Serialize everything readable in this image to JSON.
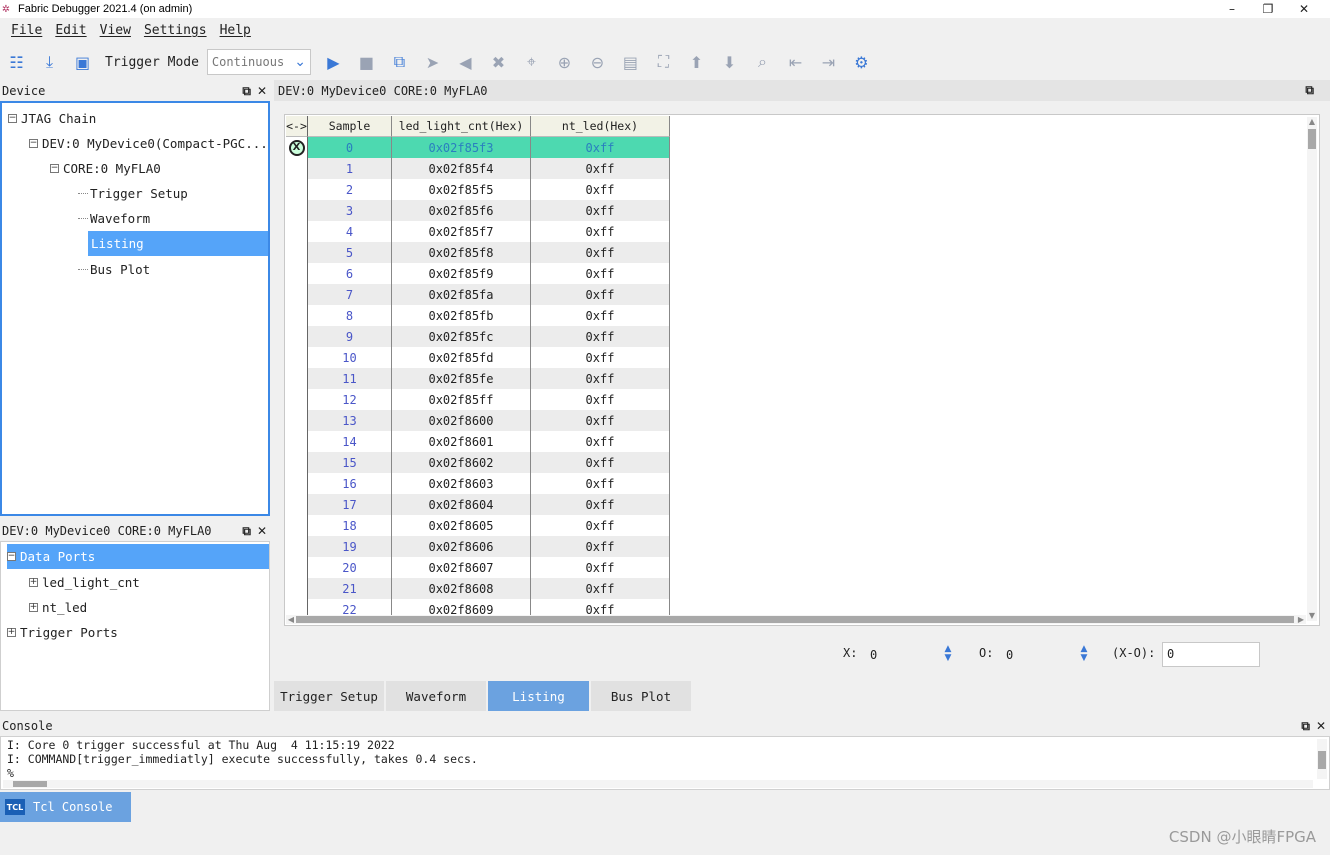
{
  "window": {
    "title": "Fabric Debugger 2021.4 (on admin)",
    "minimize": "–",
    "maximize": "❐",
    "close": "✕"
  },
  "menu": [
    "File",
    "Edit",
    "View",
    "Settings",
    "Help"
  ],
  "toolbar": {
    "trigger_mode_label": "Trigger Mode",
    "trigger_mode_value": "Continuous"
  },
  "device_panel": {
    "title": "Device",
    "tree": [
      {
        "label": "JTAG Chain",
        "expander": "−"
      },
      {
        "label": "DEV:0 MyDevice0(Compact-PGC...",
        "expander": "−"
      },
      {
        "label": "CORE:0 MyFLA0",
        "expander": "−"
      },
      {
        "label": "Trigger Setup"
      },
      {
        "label": "Waveform"
      },
      {
        "label": "Listing",
        "selected": true
      },
      {
        "label": "Bus Plot"
      }
    ]
  },
  "signal_panel": {
    "title": "DEV:0 MyDevice0 CORE:0 MyFLA0",
    "tree": [
      {
        "label": "Data Ports",
        "expander": "−",
        "selected": true
      },
      {
        "label": "led_light_cnt",
        "expander": "+"
      },
      {
        "label": "nt_led",
        "expander": "+"
      },
      {
        "label": "Trigger Ports",
        "expander": "+"
      }
    ]
  },
  "main": {
    "header": "DEV:0 MyDevice0 CORE:0 MyFLA0",
    "columns": [
      "<->",
      "Sample",
      "led_light_cnt(Hex)",
      "nt_led(Hex)"
    ],
    "rows": [
      [
        "0",
        "0x02f85f3",
        "0xff"
      ],
      [
        "1",
        "0x02f85f4",
        "0xff"
      ],
      [
        "2",
        "0x02f85f5",
        "0xff"
      ],
      [
        "3",
        "0x02f85f6",
        "0xff"
      ],
      [
        "4",
        "0x02f85f7",
        "0xff"
      ],
      [
        "5",
        "0x02f85f8",
        "0xff"
      ],
      [
        "6",
        "0x02f85f9",
        "0xff"
      ],
      [
        "7",
        "0x02f85fa",
        "0xff"
      ],
      [
        "8",
        "0x02f85fb",
        "0xff"
      ],
      [
        "9",
        "0x02f85fc",
        "0xff"
      ],
      [
        "10",
        "0x02f85fd",
        "0xff"
      ],
      [
        "11",
        "0x02f85fe",
        "0xff"
      ],
      [
        "12",
        "0x02f85ff",
        "0xff"
      ],
      [
        "13",
        "0x02f8600",
        "0xff"
      ],
      [
        "14",
        "0x02f8601",
        "0xff"
      ],
      [
        "15",
        "0x02f8602",
        "0xff"
      ],
      [
        "16",
        "0x02f8603",
        "0xff"
      ],
      [
        "17",
        "0x02f8604",
        "0xff"
      ],
      [
        "18",
        "0x02f8605",
        "0xff"
      ],
      [
        "19",
        "0x02f8606",
        "0xff"
      ],
      [
        "20",
        "0x02f8607",
        "0xff"
      ],
      [
        "21",
        "0x02f8608",
        "0xff"
      ],
      [
        "22",
        "0x02f8609",
        "0xff"
      ]
    ],
    "marker_symbol": "X",
    "readout": {
      "x_label": "X:",
      "x_value": "0",
      "o_label": "O:",
      "o_value": "0",
      "xo_label": "(X-O):",
      "xo_value": "0"
    },
    "tabs": [
      "Trigger Setup",
      "Waveform",
      "Listing",
      "Bus Plot"
    ],
    "active_tab": "Listing"
  },
  "console": {
    "title": "Console",
    "lines": [
      "I: Core 0 trigger successful at Thu Aug  4 11:15:19 2022",
      "I: COMMAND[trigger_immediatly] execute successfully, takes 0.4 secs.",
      "%"
    ],
    "tab_label": "Tcl Console",
    "tab_icon_text": "TCL"
  },
  "watermark": "CSDN @小眼睛FPGA",
  "colors": {
    "accent": "#3b88e6",
    "selected_row": "#4dd9b0",
    "active_tab": "#6ba2e0"
  }
}
